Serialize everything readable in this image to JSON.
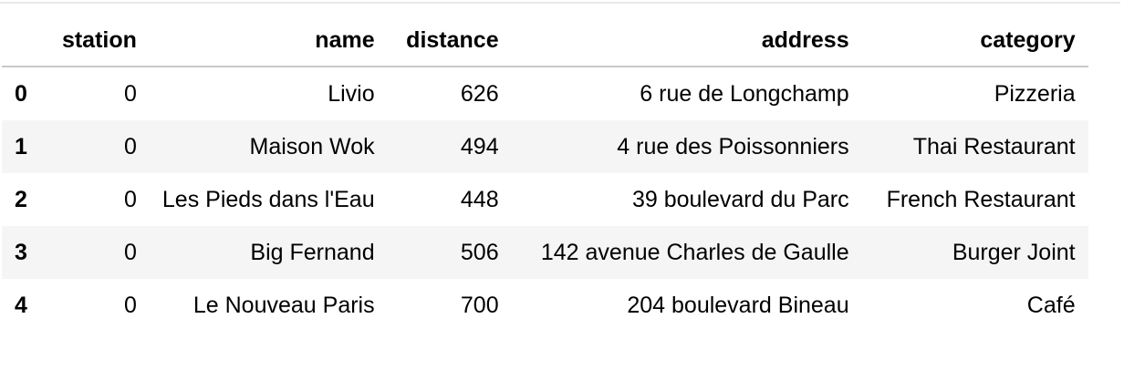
{
  "dataframe": {
    "columns": [
      "station",
      "name",
      "distance",
      "address",
      "category"
    ],
    "rows": [
      {
        "index": "0",
        "station": "0",
        "name": "Livio",
        "distance": "626",
        "address": "6 rue de Longchamp",
        "category": "Pizzeria"
      },
      {
        "index": "1",
        "station": "0",
        "name": "Maison Wok",
        "distance": "494",
        "address": "4 rue des Poissonniers",
        "category": "Thai Restaurant"
      },
      {
        "index": "2",
        "station": "0",
        "name": "Les Pieds dans l'Eau",
        "distance": "448",
        "address": "39 boulevard du Parc",
        "category": "French Restaurant"
      },
      {
        "index": "3",
        "station": "0",
        "name": "Big Fernand",
        "distance": "506",
        "address": "142 avenue Charles de Gaulle",
        "category": "Burger Joint"
      },
      {
        "index": "4",
        "station": "0",
        "name": "Le Nouveau Paris",
        "distance": "700",
        "address": "204 boulevard Bineau",
        "category": "Café"
      }
    ]
  },
  "colors": {
    "header_rule": "#c8c8c8",
    "stripe": "#f5f5f5",
    "top_rule": "#e8e8e8"
  }
}
